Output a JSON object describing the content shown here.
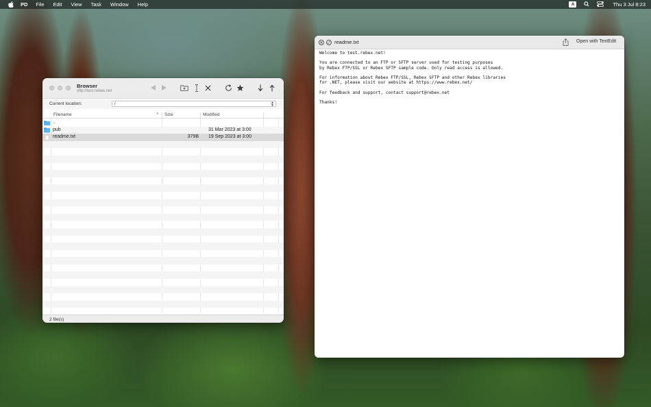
{
  "menubar": {
    "app_name": "PD",
    "items": [
      "File",
      "Edit",
      "View",
      "Task",
      "Window",
      "Help"
    ],
    "input_source": "A",
    "clock": "Thu 3 Jul  8:23"
  },
  "browser": {
    "title": "Browser",
    "subtitle": "sftp://test.rebex.net",
    "location_label": "Current location:",
    "location_value": "/",
    "columns": {
      "filename": "Filename",
      "size": "Size",
      "modified": "Modified"
    },
    "rows": [
      {
        "icon": "folder-icon",
        "name": "..",
        "size": "",
        "modified": ""
      },
      {
        "icon": "folder-icon",
        "name": "pub",
        "size": "",
        "modified": "31 Mar 2023 at 3:00"
      },
      {
        "icon": "file-icon",
        "name": "readme.txt",
        "size": "379B",
        "modified": "19 Sep 2023 at 3:00"
      }
    ],
    "status": "2 file(s)"
  },
  "viewer": {
    "title": "readme.txt",
    "open_with": "Open with TextEdit",
    "text": "Welcome to test.rebex.net!\n\nYou are connected to an FTP or SFTP server used for testing purposes\nby Rebex FTP/SSL or Rebex SFTP sample code. Only read access is allowed.\n\nFor information about Rebex FTP/SSL, Rebex SFTP and other Rebex libraries\nfor .NET, please visit our website at https://www.rebex.net/\n\nFor feedback and support, contact support@rebex.net\n\nThanks!"
  },
  "colors": {
    "folder_blue": "#3e9bde",
    "selected_row": "#dadada",
    "window_chrome": "#ececec"
  }
}
